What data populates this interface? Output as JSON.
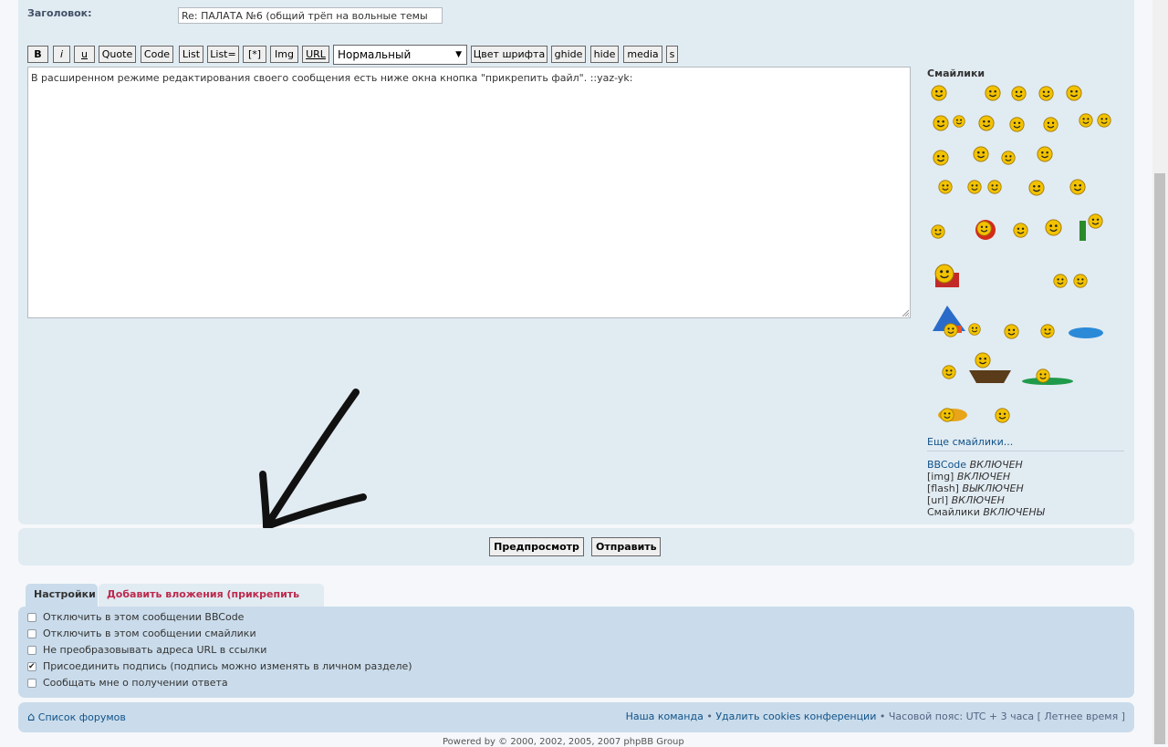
{
  "form": {
    "subject_label": "Заголовок:",
    "subject_value": "Re: ПАЛАТА №6   (общий трёп на вольные темы",
    "message_text": "В расширенном режиме редактирования своего сообщения есть ниже окна кнопка \"прикрепить файл\". ::yaz-yk:"
  },
  "toolbar": {
    "bold": "B",
    "italic": "i",
    "underline": "u",
    "quote": "Quote",
    "code": "Code",
    "list": "List",
    "list_ordered": "List=",
    "list_item": "[*]",
    "img": "Img",
    "url": "URL",
    "font_size_selected": "Нормальный",
    "font_color": "Цвет шрифта",
    "ghide": "ghide",
    "hide": "hide",
    "media": "media",
    "s": "s"
  },
  "smilies": {
    "title": "Смайлики",
    "more": "Еще смайлики...",
    "accent": "#f2c200"
  },
  "status": {
    "bbcode_label": "BBCode",
    "bbcode_state": "ВКЛЮЧЕН",
    "img_label": "[img]",
    "img_state": "ВКЛЮЧЕН",
    "flash_label": "[flash]",
    "flash_state": "ВЫКЛЮЧЕН",
    "url_label": "[url]",
    "url_state": "ВКЛЮЧЕН",
    "smilies_label": "Смайлики",
    "smilies_state": "ВКЛЮЧЕНЫ"
  },
  "buttons": {
    "preview": "Предпросмотр",
    "submit": "Отправить"
  },
  "tabs": {
    "settings": "Настройки",
    "attachments": "Добавить вложения (прикрепить фото)"
  },
  "options": [
    {
      "label": "Отключить в этом сообщении BBCode",
      "checked": false
    },
    {
      "label": "Отключить в этом сообщении смайлики",
      "checked": false
    },
    {
      "label": "Не преобразовывать адреса URL в ссылки",
      "checked": false
    },
    {
      "label": "Присоединить подпись (подпись можно изменять в личном разделе)",
      "checked": true
    },
    {
      "label": "Сообщать мне о получении ответа",
      "checked": false
    }
  ],
  "footer": {
    "forum_list": "Список форумов",
    "team": "Наша команда",
    "delete_cookies": "Удалить cookies конференции",
    "timezone": "Часовой пояс: UTC + 3 часа [ Летнее время ]",
    "separator": "•",
    "powered": "Powered by © 2000, 2002, 2005, 2007 phpBB Group"
  },
  "colors": {
    "panel": "#e1ebf2",
    "panel_dark": "#cadceb",
    "link": "#105289",
    "tab_inactive_text": "#bc2a4d"
  }
}
